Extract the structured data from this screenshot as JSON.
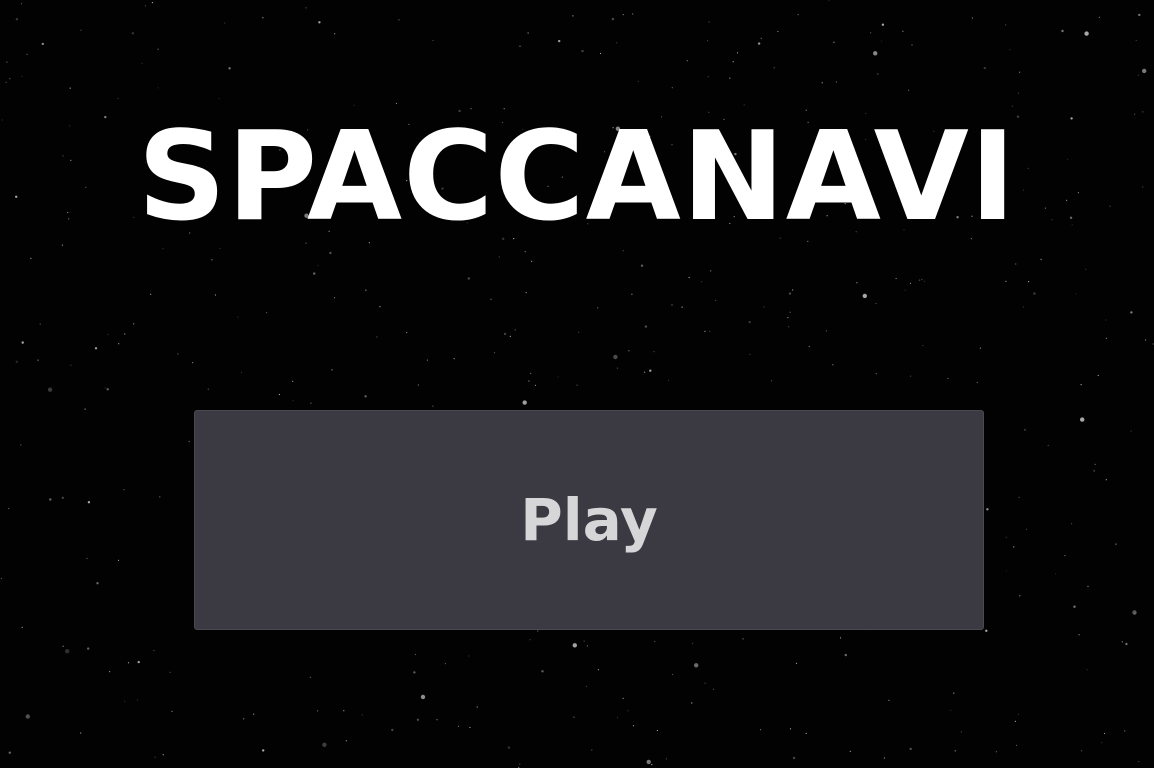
{
  "game": {
    "title": "SPACCANAVI",
    "play_label": "Play"
  },
  "colors": {
    "background": "#020202",
    "title": "#ffffff",
    "button_background": "#3b3a42",
    "button_text": "#d6d6d8"
  }
}
